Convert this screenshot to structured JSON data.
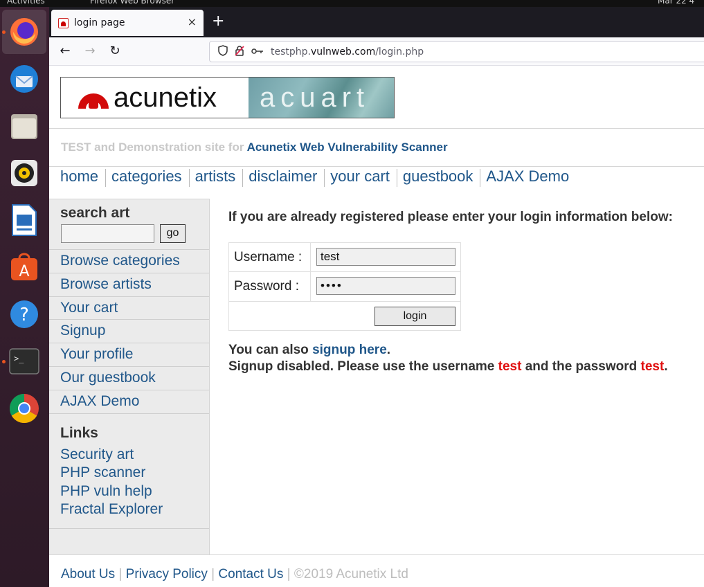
{
  "system": {
    "topbar_left": "Activities",
    "topbar_app": "Firefox Web Browser",
    "topbar_right": "Mar 22  4"
  },
  "dock": {
    "items": [
      "firefox-icon",
      "thunderbird-icon",
      "files-icon",
      "rhythmbox-icon",
      "writer-icon",
      "software-icon",
      "help-icon",
      "terminal-icon",
      "chrome-icon"
    ],
    "accent": "#e95420"
  },
  "browser": {
    "tab_title": "login page",
    "tab_close": "×",
    "new_tab": "+",
    "back": "←",
    "forward": "→",
    "reload": "↻",
    "url_prefix": "testphp.",
    "url_host": "vulnweb.com",
    "url_path": "/login.php"
  },
  "site": {
    "logo_left": "acunetix",
    "logo_right": "acuart",
    "tagline_prefix": "TEST and Demonstration site for ",
    "tagline_link": "Acunetix Web Vulnerability Scanner",
    "nav": [
      "home",
      "categories",
      "artists",
      "disclaimer",
      "your cart",
      "guestbook",
      "AJAX Demo"
    ],
    "link_color": "#20578a"
  },
  "sidebar": {
    "search_title": "search art",
    "search_value": "",
    "search_button": "go",
    "items": [
      "Browse categories",
      "Browse artists",
      "Your cart",
      "Signup",
      "Your profile",
      "Our guestbook",
      "AJAX Demo"
    ],
    "links_title": "Links",
    "links": [
      "Security art",
      "PHP scanner",
      "PHP vuln help",
      "Fractal Explorer"
    ]
  },
  "main": {
    "intro": "If you are already registered please enter your login information below:",
    "username_label": "Username :",
    "username_value": "test",
    "password_label": "Password :",
    "password_value": "••••",
    "login_button": "login",
    "also_prefix": "You can also ",
    "also_link": "signup here",
    "also_suffix": ".",
    "disabled_prefix": "Signup disabled. Please use the username ",
    "disabled_user": "test",
    "disabled_mid": " and the password ",
    "disabled_pass": "test",
    "disabled_suffix": ".",
    "warning_color": "#e01010"
  },
  "footer": {
    "about": "About Us",
    "privacy": "Privacy Policy",
    "contact": "Contact Us",
    "sep": " | ",
    "copyright": "©2019 Acunetix Ltd"
  }
}
